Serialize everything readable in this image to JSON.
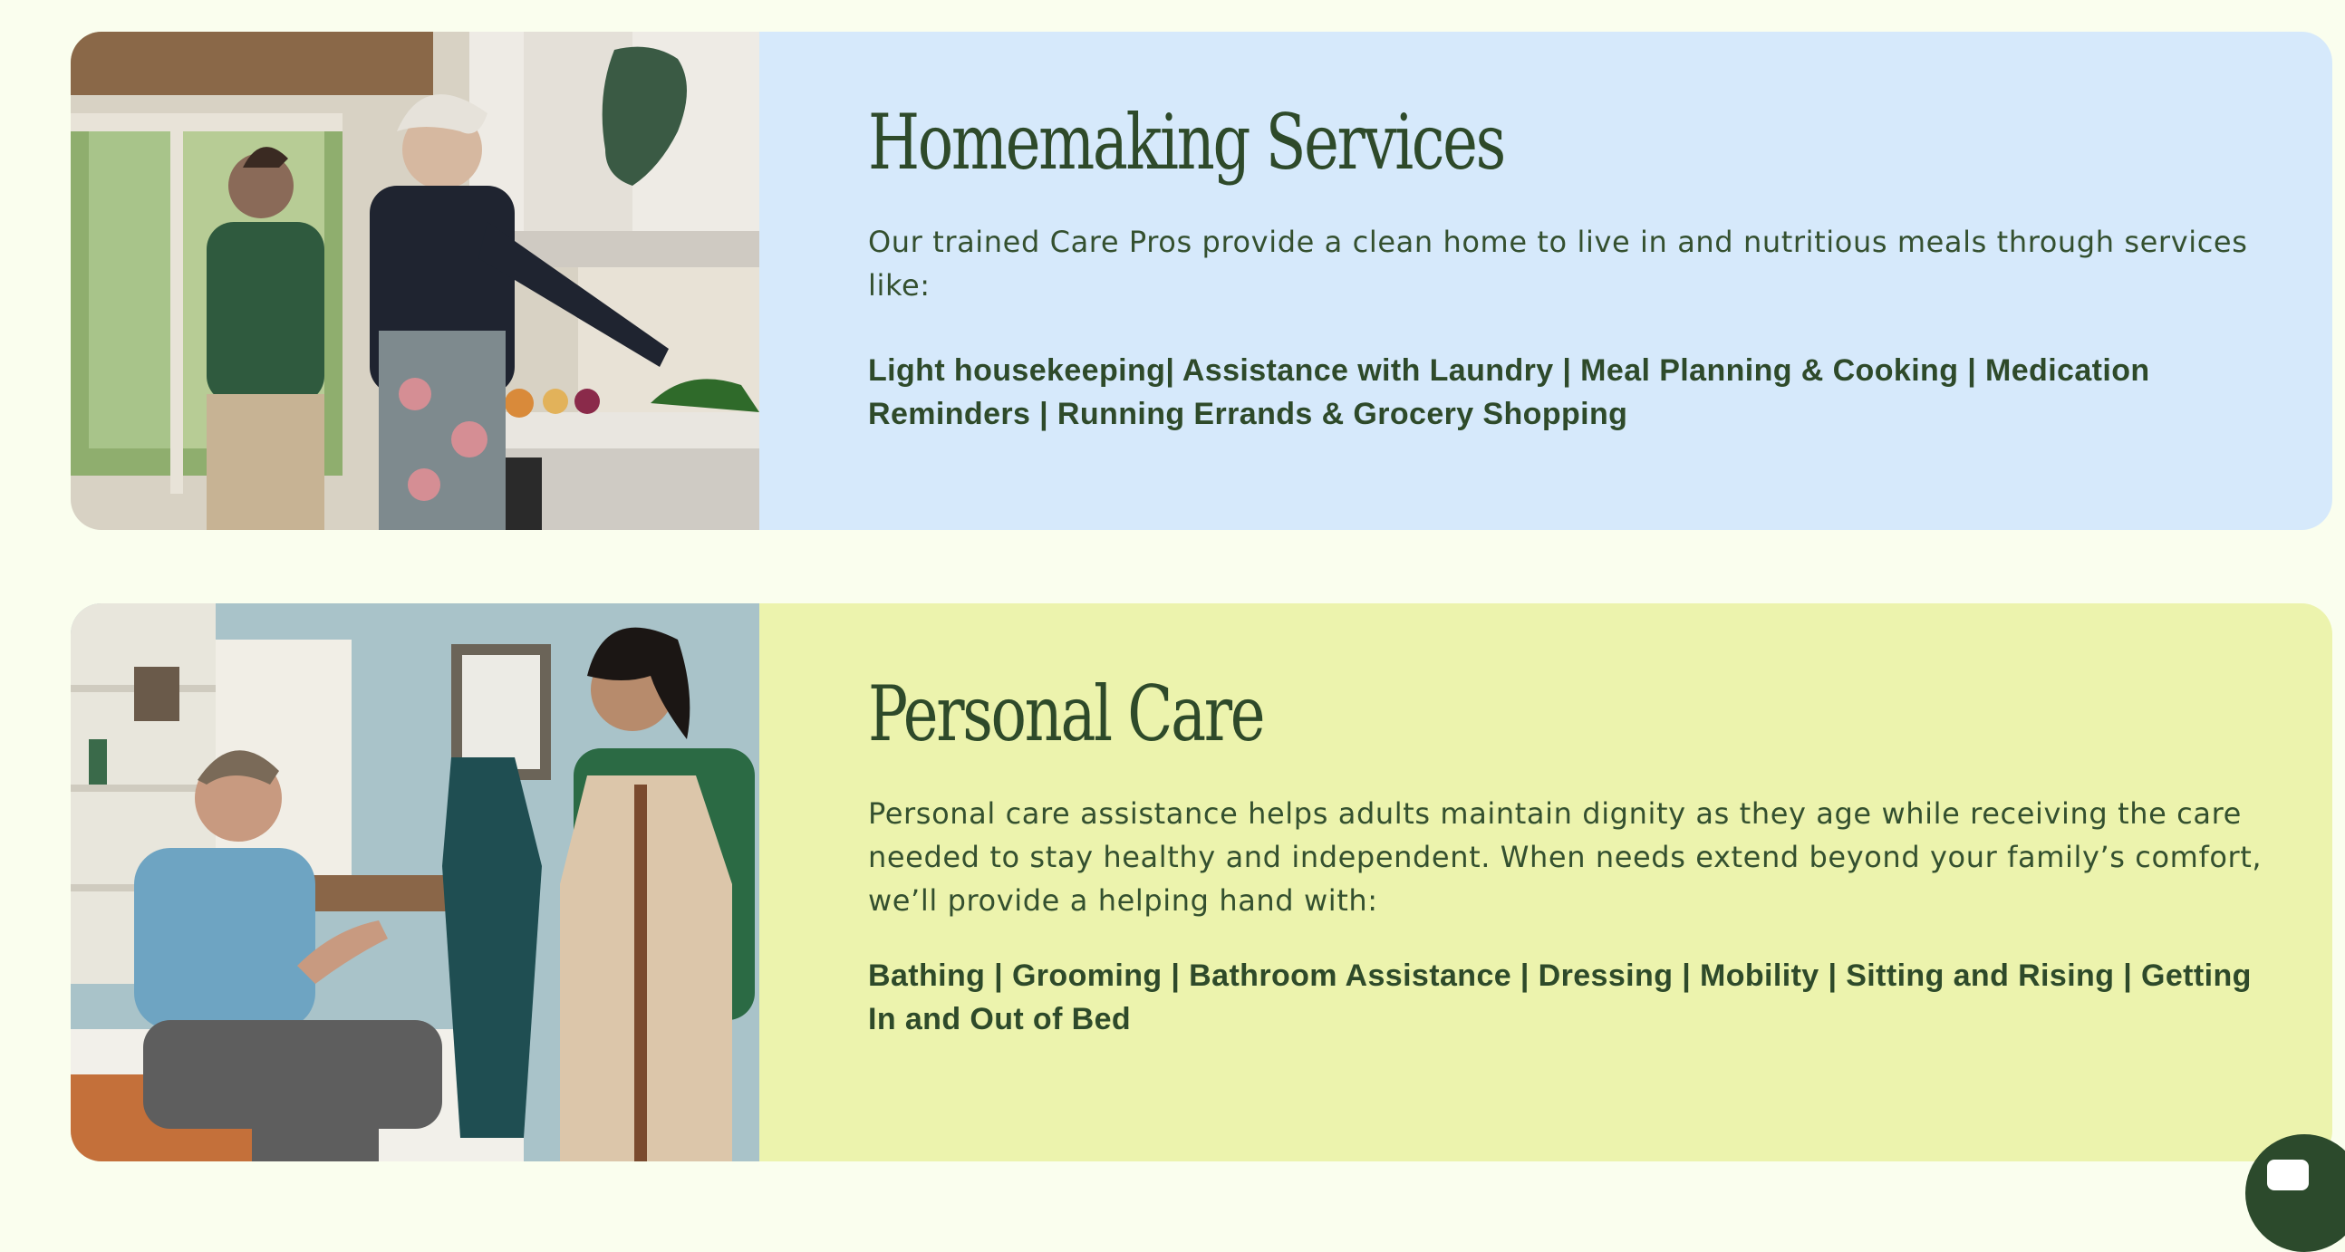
{
  "sections": [
    {
      "title": "Homemaking Services",
      "description": "Our trained Care Pros provide a clean home to live in and nutritious meals through services like:",
      "services": "Light housekeeping| Assistance with Laundry | Meal Planning & Cooking | Medication Reminders | Running Errands & Grocery Shopping",
      "background": "#d6e9fb"
    },
    {
      "title": "Personal Care",
      "description": "Personal care assistance helps adults maintain dignity as they age while receiving the care needed to stay healthy and independent. When needs extend beyond your family’s comfort, we’ll provide a helping hand with:",
      "services": "Bathing | Grooming | Bathroom Assistance | Dressing | Mobility | Sitting and Rising | Getting In and Out of Bed",
      "background": "#ecf3ad"
    }
  ],
  "page_background": "#fafeee",
  "chat_button": {
    "icon": "chat-icon",
    "color": "#2c4a2c"
  }
}
